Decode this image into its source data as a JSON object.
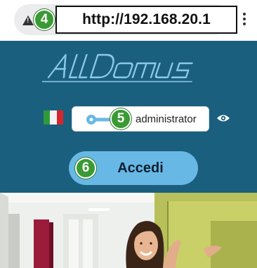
{
  "browser": {
    "url": "http://192.168.20.1",
    "warning_icon": "warning-triangle-icon",
    "menu_icon": "more-vert-icon"
  },
  "steps": {
    "url": "4",
    "password": "5",
    "login": "6"
  },
  "app": {
    "brand": "AllDomus",
    "language_flag": "italy-flag-icon",
    "password_field": {
      "value": "administrator",
      "icon": "key-icon"
    },
    "show_password_icon": "eye-icon",
    "login_button_label": "Accedi",
    "colors": {
      "panel_bg": "#1b5f7e",
      "button_bg": "#68b8e6",
      "key_color": "#68b8e6",
      "badge_green": "#3a9a34"
    }
  },
  "photo": {
    "subject": "smiling-woman-interior-photo"
  }
}
